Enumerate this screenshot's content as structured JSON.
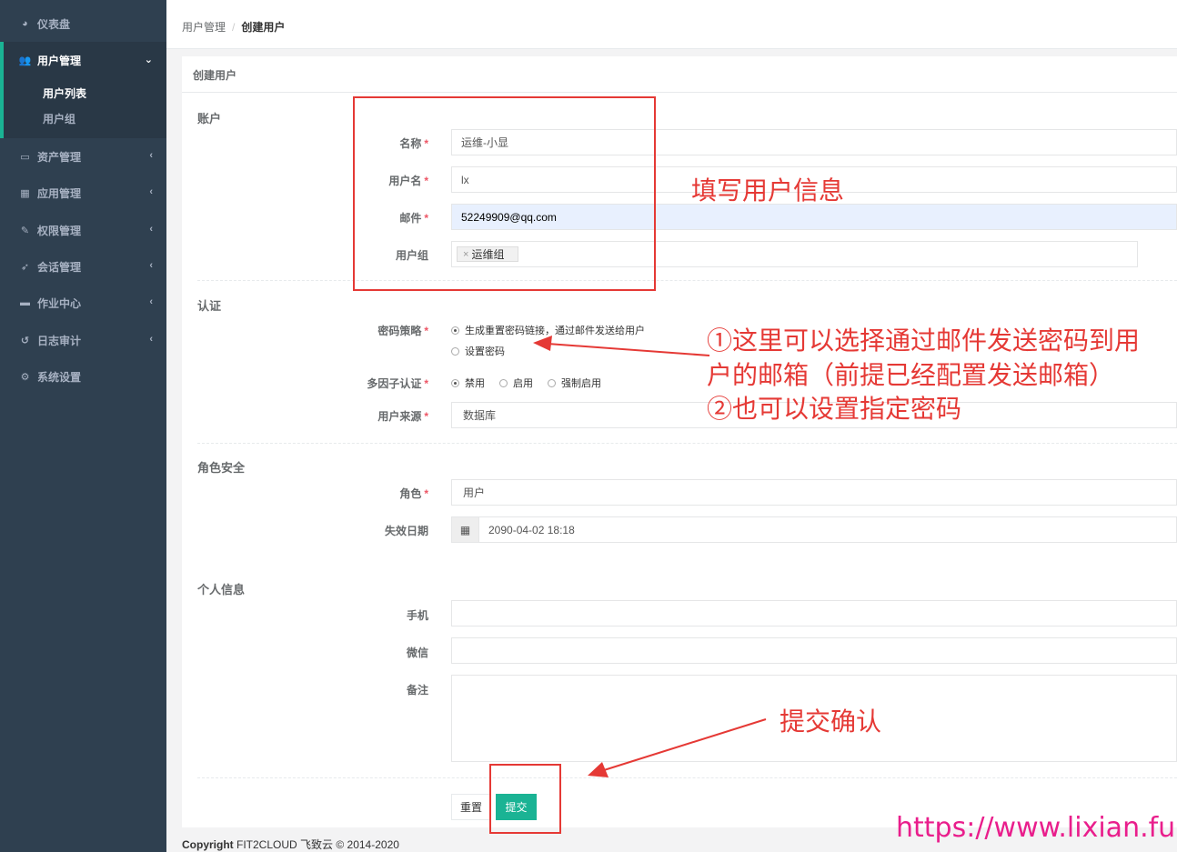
{
  "sidebar": {
    "items": [
      {
        "label": "仪表盘",
        "icon": "dashboard-icon"
      },
      {
        "label": "用户管理",
        "icon": "users-icon"
      },
      {
        "label": "资产管理",
        "icon": "inbox-icon"
      },
      {
        "label": "应用管理",
        "icon": "grid-icon"
      },
      {
        "label": "权限管理",
        "icon": "edit-icon"
      },
      {
        "label": "会话管理",
        "icon": "rocket-icon"
      },
      {
        "label": "作业中心",
        "icon": "keyboard-icon"
      },
      {
        "label": "日志审计",
        "icon": "history-icon"
      },
      {
        "label": "系统设置",
        "icon": "gears-icon"
      }
    ],
    "sub_items": [
      {
        "label": "用户列表"
      },
      {
        "label": "用户组"
      }
    ]
  },
  "breadcrumb": {
    "parent": "用户管理",
    "separator": "/",
    "current": "创建用户"
  },
  "card": {
    "title": "创建用户"
  },
  "sections": {
    "account": "账户",
    "auth": "认证",
    "role": "角色安全",
    "personal": "个人信息"
  },
  "fields": {
    "name": {
      "label": "名称",
      "value": "运维-小显"
    },
    "username": {
      "label": "用户名",
      "value": "lx"
    },
    "email": {
      "label": "邮件",
      "value": "52249909@qq.com"
    },
    "group": {
      "label": "用户组",
      "tag": "运维组",
      "tag_remove": "×"
    },
    "password_strategy": {
      "label": "密码策略",
      "options": [
        "生成重置密码链接，通过邮件发送给用户",
        "设置密码"
      ],
      "selected": 0
    },
    "mfa": {
      "label": "多因子认证",
      "options": [
        "禁用",
        "启用",
        "强制启用"
      ],
      "selected": 0
    },
    "source": {
      "label": "用户来源",
      "value": "数据库"
    },
    "role": {
      "label": "角色",
      "value": "用户"
    },
    "expire": {
      "label": "失效日期",
      "value": "2090-04-02 18:18"
    },
    "phone": {
      "label": "手机",
      "value": ""
    },
    "wechat": {
      "label": "微信",
      "value": ""
    },
    "comment": {
      "label": "备注",
      "value": ""
    }
  },
  "required_mark": "*",
  "buttons": {
    "reset": "重置",
    "submit": "提交"
  },
  "footer": {
    "brand": "Copyright",
    "text": "FIT2CLOUD 飞致云 © 2014-2020"
  },
  "annotations": {
    "fill_info": "填写用户信息",
    "password_line1": "①这里可以选择通过邮件发送密码到用",
    "password_line2": "户的邮箱（前提已经配置发送邮箱）",
    "password_line3": "②也可以设置指定密码",
    "submit_confirm": "提交确认",
    "watermark": "https://www.lixian.fun"
  },
  "colors": {
    "accent": "#1ab394",
    "sidebar": "#2f4050",
    "annotation": "#e53935",
    "watermark": "#e91e8c"
  }
}
